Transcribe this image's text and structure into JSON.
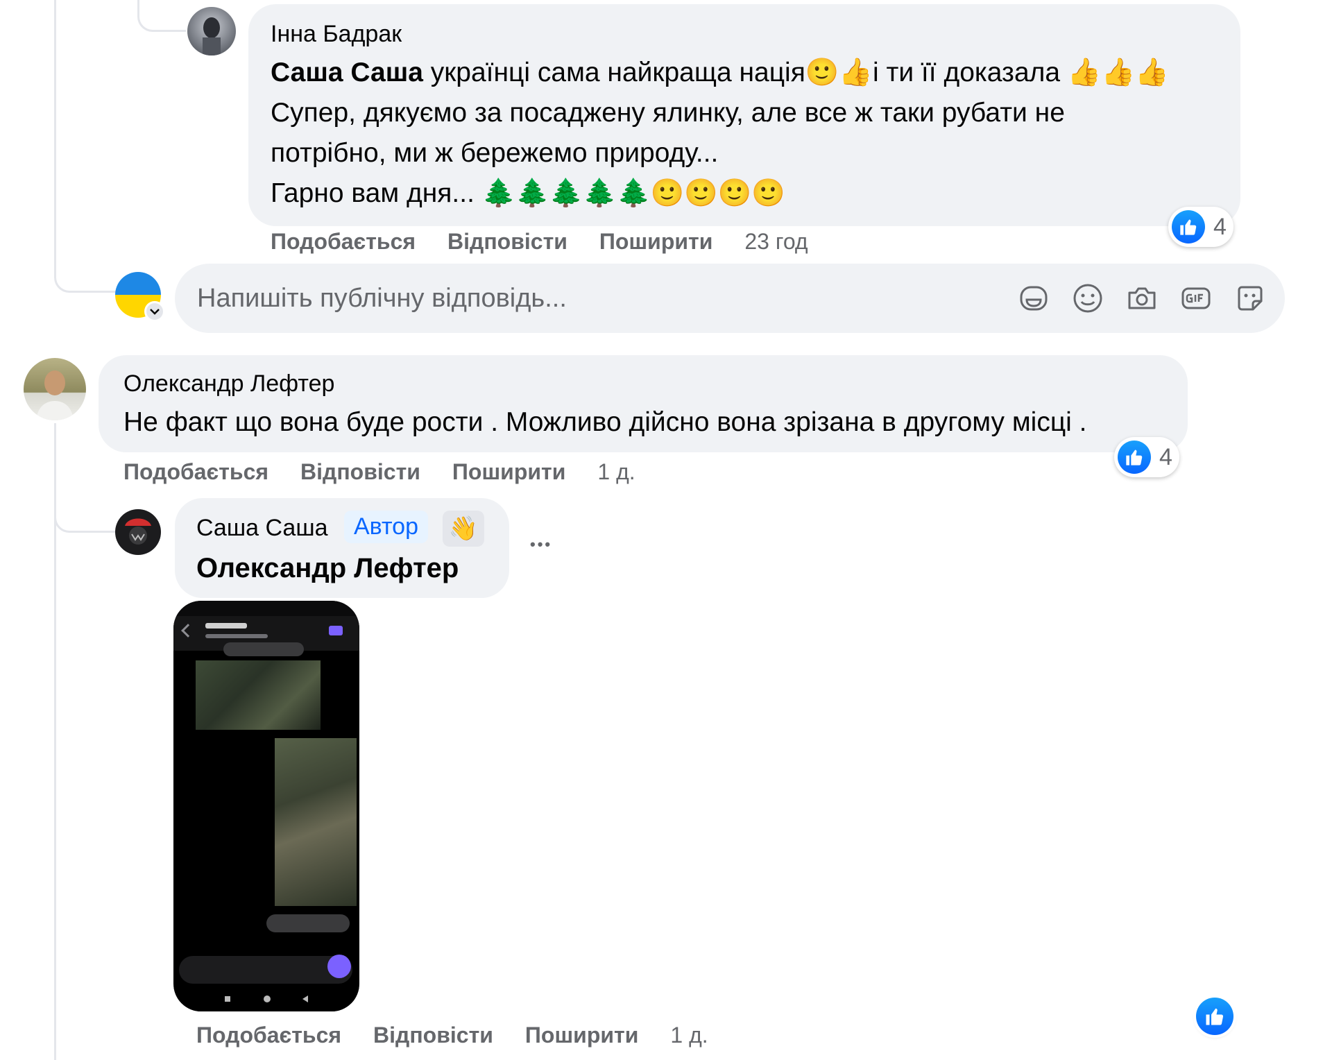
{
  "comments": {
    "inna": {
      "author": "Інна Бадрак",
      "mention": "Саша Саша",
      "line1": "українці сама найкраща нація🙂👍і ти її доказала 👍👍👍",
      "line2": "Супер, дякуємо за посаджену ялинку, але все ж таки рубати не",
      "line3": "потрібно, ми ж бережемо природу...",
      "line4": "Гарно вам дня... 🌲🌲🌲🌲🌲🙂🙂🙂🙂",
      "actions": {
        "like": "Подобається",
        "reply": "Відповісти",
        "share": "Поширити",
        "time": "23 год"
      },
      "reaction_count": "4"
    },
    "reply_box": {
      "placeholder": "Напишіть публічну відповідь...",
      "icons": [
        "avatar-sticker-icon",
        "emoji-icon",
        "camera-icon",
        "gif-icon",
        "sticker-icon"
      ]
    },
    "oleksandr": {
      "author": "Олександр Лефтер",
      "text": "Не факт що вона буде рости . Можливо дійсно вона зрізана в другому місці .",
      "actions": {
        "like": "Подобається",
        "reply": "Відповісти",
        "share": "Поширити",
        "time": "1 д."
      },
      "reaction_count": "4"
    },
    "sasha": {
      "author": "Саша Саша",
      "badge": "Автор",
      "badge_icon": "👋",
      "mention": "Олександр Лефтер",
      "more": "•••",
      "actions": {
        "like": "Подобається",
        "reply": "Відповісти",
        "share": "Поширити",
        "time": "1 д."
      }
    }
  },
  "colors": {
    "bubble": "#f0f2f5",
    "secondary_text": "#65676b",
    "like_blue": "#0866ff",
    "author_badge_bg": "#e7f3ff"
  }
}
